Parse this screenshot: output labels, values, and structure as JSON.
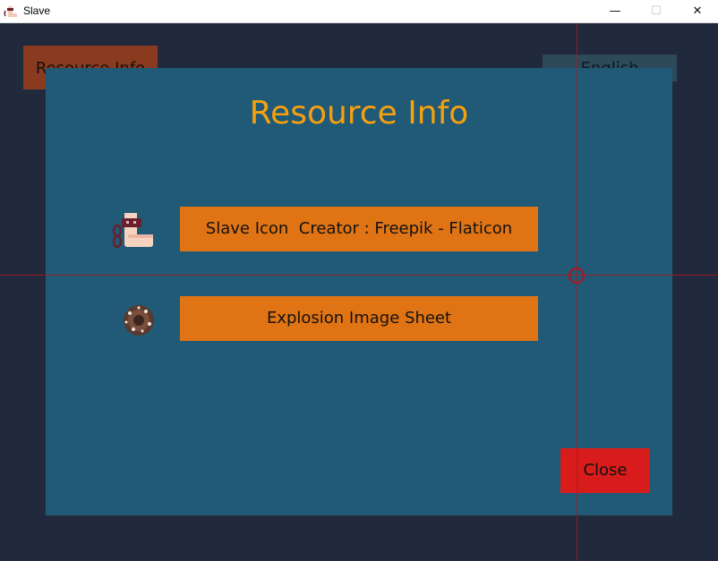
{
  "window": {
    "title": "Slave",
    "minimize_glyph": "—",
    "maximize_glyph": "☐",
    "close_glyph": "✕"
  },
  "background": {
    "left_button_label": "Resource Info",
    "right_button_label": "English"
  },
  "modal": {
    "title": "Resource Info",
    "resources": [
      {
        "icon": "shackled-foot-icon",
        "label": "Slave Icon  Creator : Freepik - Flaticon"
      },
      {
        "icon": "explosion-icon",
        "label": "Explosion Image Sheet"
      }
    ],
    "close_label": "Close"
  },
  "colors": {
    "app_background": "#212a3d",
    "modal_background": "#215a76",
    "title_accent": "#f5a00f",
    "resource_button": "#e07414",
    "close_button": "#d81c1c",
    "crosshair": "#b0141e"
  }
}
